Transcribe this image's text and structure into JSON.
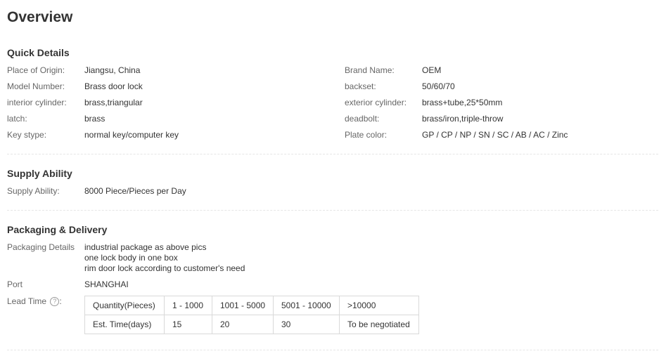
{
  "title": "Overview",
  "quick_details": {
    "heading": "Quick Details",
    "left": [
      {
        "label": "Place of Origin:",
        "value": "Jiangsu, China"
      },
      {
        "label": "Model Number:",
        "value": "Brass door lock"
      },
      {
        "label": "interior cylinder:",
        "value": "brass,triangular"
      },
      {
        "label": "latch:",
        "value": "brass"
      },
      {
        "label": "Key stype:",
        "value": "normal key/computer key"
      }
    ],
    "right": [
      {
        "label": "Brand Name:",
        "value": "OEM"
      },
      {
        "label": "backset:",
        "value": "50/60/70"
      },
      {
        "label": "exterior cylinder:",
        "value": "brass+tube,25*50mm"
      },
      {
        "label": "deadbolt:",
        "value": "brass/iron,triple-throw"
      },
      {
        "label": "Plate color:",
        "value": "GP / CP / NP / SN / SC / AB / AC / Zinc"
      }
    ]
  },
  "supply_ability": {
    "heading": "Supply Ability",
    "label": "Supply Ability:",
    "value": "8000 Piece/Pieces per Day"
  },
  "packaging_delivery": {
    "heading": "Packaging & Delivery",
    "packaging_label": "Packaging Details",
    "packaging_lines": [
      "industrial package as above pics",
      "one lock body in one box",
      "rim door lock according to customer's need"
    ],
    "port_label": "Port",
    "port_value": "SHANGHAI",
    "lead_time_label": "Lead Time",
    "lead_time_help_icon": "question-circle-icon",
    "lead_time_table": {
      "row1": [
        "Quantity(Pieces)",
        "1 - 1000",
        "1001 - 5000",
        "5001 - 10000",
        ">10000"
      ],
      "row2": [
        "Est. Time(days)",
        "15",
        "20",
        "30",
        "To be negotiated"
      ]
    }
  }
}
